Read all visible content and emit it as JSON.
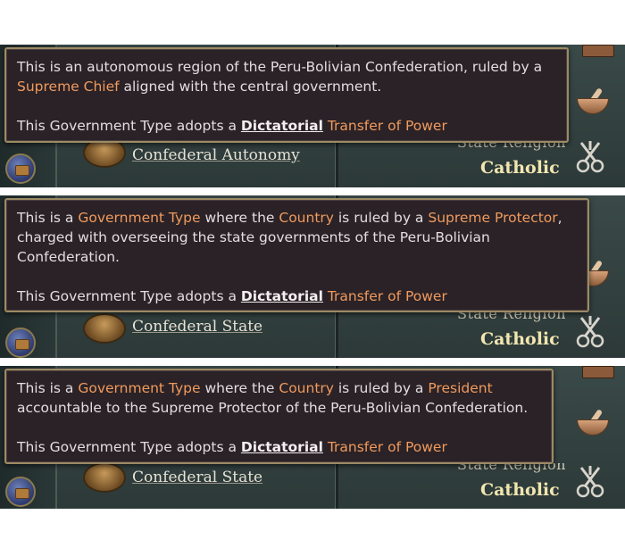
{
  "panels": [
    {
      "gov_name": "Confederal Autonomy",
      "religion_label": "State Religion",
      "religion_value": "Catholic",
      "tooltip": {
        "line1_pre": "This is an autonomous region of the Peru-Bolivian Confederation, ruled by a",
        "line2_ruler": "Supreme Chief",
        "line2_post": " aligned with the central government.",
        "transfer_pre": "This Government Type adopts a ",
        "transfer_kw": "Dictatorial",
        "transfer_post": " Transfer of Power"
      }
    },
    {
      "gov_name": "Confederal State",
      "religion_label": "State Religion",
      "religion_value": "Catholic",
      "tooltip": {
        "pre": "This is a ",
        "gov_type": "Government Type",
        "mid1": " where the ",
        "country": "Country",
        "mid2": " is ruled by a ",
        "ruler": "Supreme Protector",
        "comma": ",",
        "line2": "charged with overseeing the state governments of the Peru-Bolivian",
        "line3": "Confederation.",
        "transfer_pre": "This Government Type adopts a ",
        "transfer_kw": "Dictatorial",
        "transfer_post": " Transfer of Power"
      }
    },
    {
      "gov_name": "Confederal State",
      "religion_label": "State Religion",
      "religion_value": "Catholic",
      "tooltip": {
        "pre": "This is a ",
        "gov_type": "Government Type",
        "mid1": " where the ",
        "country": "Country",
        "mid2": " is ruled by a ",
        "ruler": "President",
        "line2": "accountable to the Supreme Protector of the Peru-Bolivian Confederation.",
        "transfer_pre": "This Government Type adopts a ",
        "transfer_kw": "Dictatorial",
        "transfer_post": " Transfer of Power"
      }
    }
  ],
  "icons": {
    "side_button": "briefcase-icon",
    "government": "government-icon",
    "religion": "papal-keys-icon",
    "trade": "mortar-pestle-icon"
  },
  "colors": {
    "highlight": "#f09a5e",
    "tooltip_bg": "#2a2226",
    "tooltip_border": "#9c8a64",
    "religion_value": "#f1e6b0"
  }
}
